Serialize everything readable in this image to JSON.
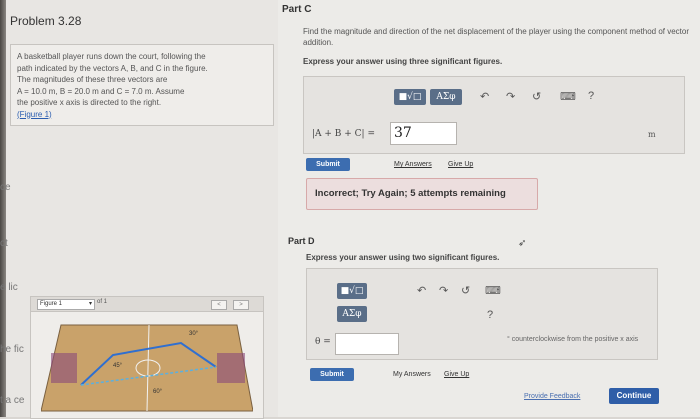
{
  "edge_text": [
    "ce",
    "ct",
    "e lic",
    "he fic",
    "t a ce"
  ],
  "problem": {
    "title": "Problem 3.28",
    "lines": [
      "A basketball player runs down the court, following the",
      "path indicated by the vectors A, B, and C in the figure.",
      "The magnitudes of these three vectors are",
      "A = 10.0 m, B = 20.0 m and C = 7.0 m. Assume",
      "the positive x axis is directed to the right."
    ],
    "figure_link": "(Figure 1)"
  },
  "figure": {
    "select_label": "Figure 1",
    "of_label": "of 1",
    "prev": "<",
    "next": ">",
    "angle_labels": [
      "30°",
      "45°",
      "60°"
    ]
  },
  "part_c": {
    "label": "Part C",
    "description": "Find the magnitude and direction of the net displacement of the player using the component method of vector addition.",
    "instruction": "Express your answer using three significant figures.",
    "toolbar": {
      "sqrt_btn": "■√□",
      "greek_btn": "AΣφ",
      "undo": "↶",
      "redo": "↷",
      "reset": "↺",
      "keyboard": "⌨",
      "help": "?"
    },
    "expression_label": "|A + B + C| =",
    "answer_value": "37",
    "unit": "m",
    "submit_label": "Submit",
    "my_answers": "My Answers",
    "give_up": "Give Up",
    "feedback": "Incorrect; Try Again; 5 attempts remaining"
  },
  "part_d": {
    "label": "Part D",
    "instruction": "Express your answer using two significant figures.",
    "toolbar": {
      "sqrt_btn": "■√□",
      "greek_btn": "AΣφ",
      "undo": "↶",
      "redo": "↷",
      "reset": "↺",
      "keyboard": "⌨",
      "help": "?"
    },
    "theta_label": "θ =",
    "answer_value": "",
    "note": "° counterclockwise from the positive x axis",
    "submit_label": "Submit",
    "my_answers": "My Answers",
    "give_up": "Give Up"
  },
  "footer": {
    "provide_feedback": "Provide Feedback",
    "continue": "Continue"
  }
}
